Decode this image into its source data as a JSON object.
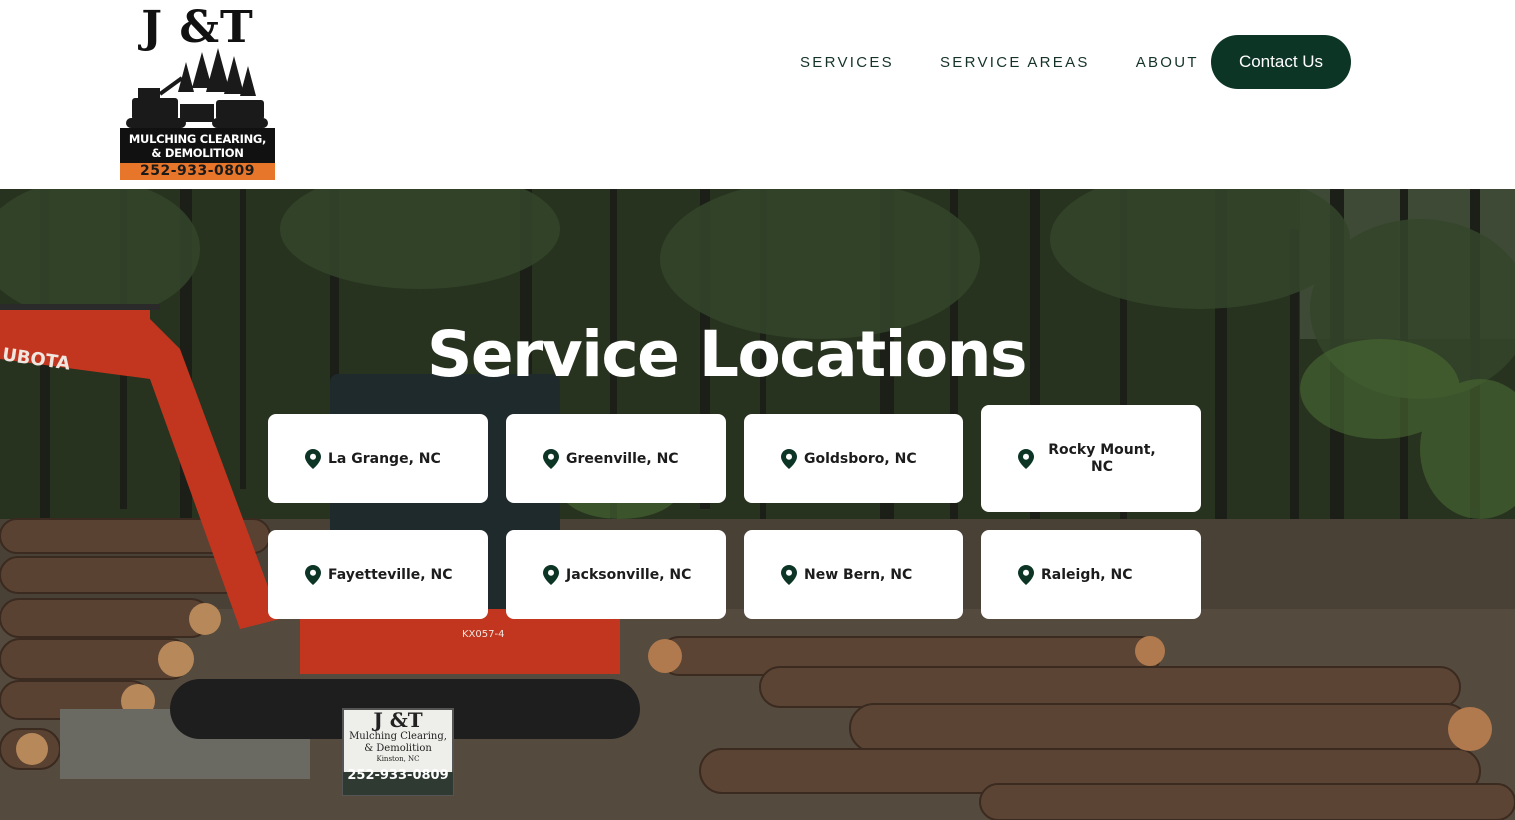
{
  "brand": {
    "logo_title": "J &T",
    "logo_line1": "MULCHING CLEARING,",
    "logo_line2": "& DEMOLITION",
    "logo_phone": "252-933-0809"
  },
  "nav": {
    "items": [
      {
        "label": "SERVICES"
      },
      {
        "label": "SERVICE AREAS"
      },
      {
        "label": "ABOUT"
      }
    ],
    "contact_label": "Contact Us"
  },
  "hero": {
    "title": "Service Locations",
    "sign_line1": "J &T",
    "sign_line2": "Mulching Clearing,",
    "sign_line3": "& Demolition",
    "sign_line4": "Kinston, NC",
    "sign_phone": "252-933-0809",
    "machine_brand": "UBOTA",
    "machine_model": "KX057-4"
  },
  "locations": [
    {
      "label": "La Grange, NC"
    },
    {
      "label": "Greenville, NC"
    },
    {
      "label": "Goldsboro, NC"
    },
    {
      "label": "Rocky Mount, NC"
    },
    {
      "label": "Fayetteville, NC"
    },
    {
      "label": "Jacksonville, NC"
    },
    {
      "label": "New Bern, NC"
    },
    {
      "label": "Raleigh, NC"
    }
  ],
  "colors": {
    "brand_green": "#0d3526",
    "nav_text": "#153328",
    "logo_orange": "#e8762a",
    "excavator_orange": "#c2361f"
  }
}
